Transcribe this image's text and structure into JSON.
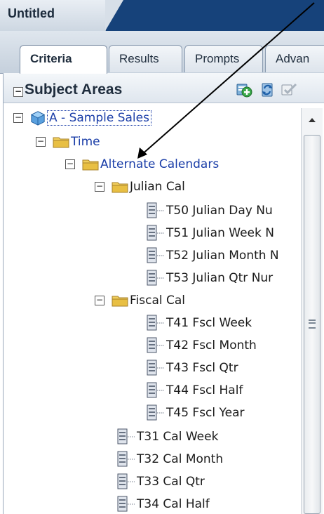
{
  "document_tab": "Untitled",
  "tabs": [
    "Criteria",
    "Results",
    "Prompts",
    "Advan"
  ],
  "panel": {
    "title": "Subject Areas",
    "collapse_symbol": "⊟"
  },
  "tree": [
    {
      "label": "A - Sample Sales",
      "type": "subject-area",
      "expander": "⊟"
    },
    {
      "label": "Time",
      "type": "folder",
      "expander": "⊟"
    },
    {
      "label": "Alternate Calendars",
      "type": "folder",
      "expander": "⊟"
    },
    {
      "label": "Julian Cal",
      "type": "folder",
      "expander": "⊟"
    },
    {
      "label": "T50 Julian Day Nu",
      "type": "column"
    },
    {
      "label": "T51 Julian Week N",
      "type": "column"
    },
    {
      "label": "T52 Julian Month N",
      "type": "column"
    },
    {
      "label": "T53 Julian Qtr Nur",
      "type": "column"
    },
    {
      "label": "Fiscal Cal",
      "type": "folder",
      "expander": "⊟"
    },
    {
      "label": "T41 Fscl Week",
      "type": "column"
    },
    {
      "label": "T42 Fscl Month",
      "type": "column"
    },
    {
      "label": "T43 Fscl Qtr",
      "type": "column"
    },
    {
      "label": "T44 Fscl Half",
      "type": "column"
    },
    {
      "label": "T45 Fscl Year",
      "type": "column"
    },
    {
      "label": "T31 Cal Week",
      "type": "column"
    },
    {
      "label": "T32 Cal Month",
      "type": "column"
    },
    {
      "label": "T33 Cal Qtr",
      "type": "column"
    },
    {
      "label": "T34 Cal Half",
      "type": "column"
    }
  ],
  "icons": {
    "add": "add-icon",
    "refresh": "refresh-icon",
    "properties": "properties-icon"
  },
  "colors": {
    "title_bar": "#16427a",
    "link_text": "#1b3ea8",
    "folder": "#e8c04a",
    "arrow": "#000000"
  }
}
